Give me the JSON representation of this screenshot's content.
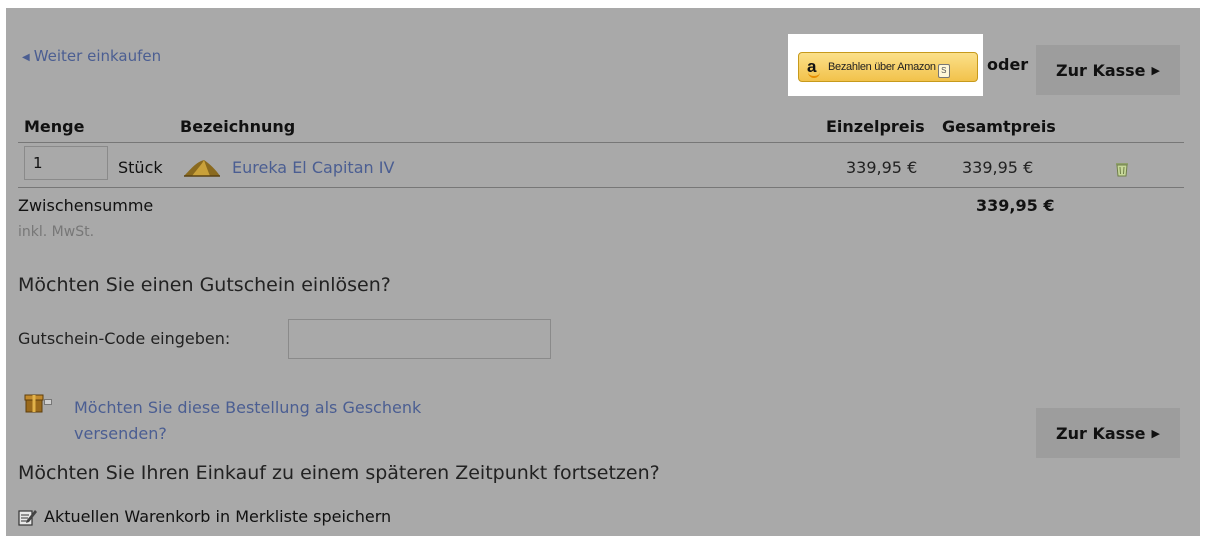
{
  "header": {
    "continue_shopping": "Weiter einkaufen",
    "amazon_pay_label": "Bezahlen über Amazon",
    "amazon_badge": "S",
    "or_label": "oder",
    "checkout_label": "Zur Kasse"
  },
  "table": {
    "headers": {
      "quantity": "Menge",
      "description": "Bezeichnung",
      "unit_price": "Einzelpreis",
      "total_price": "Gesamtpreis"
    },
    "rows": [
      {
        "quantity": "1",
        "unit": "Stück",
        "product_name": "Eureka El Capitan IV",
        "unit_price": "339,95 €",
        "total_price": "339,95 €"
      }
    ],
    "subtotal_label": "Zwischensumme",
    "subtotal_value": "339,95 €",
    "vat_note": "inkl. MwSt."
  },
  "coupon": {
    "question": "Möchten Sie einen Gutschein einlösen?",
    "code_label": "Gutschein-Code eingeben:",
    "code_value": ""
  },
  "gift": {
    "link_text": "Möchten Sie diese Bestellung als Geschenk versenden?"
  },
  "footer": {
    "checkout_label": "Zur Kasse",
    "later_question": "Möchten Sie Ihren Einkauf zu einem späteren Zeitpunkt fortsetzen?",
    "save_to_wishlist": "Aktuellen Warenkorb in Merkliste speichern"
  },
  "colors": {
    "page_background": "#a9a9a9",
    "link": "#4b5e92",
    "amazon_button": "#f2c24b",
    "checkout_button": "#9d9d9d"
  },
  "icons": {
    "continue_arrow": "triangle-left-icon",
    "checkout_arrow": "triangle-right-icon",
    "product": "tent-icon",
    "remove": "trash-icon",
    "gift": "gift-box-icon",
    "save": "note-edit-icon"
  }
}
